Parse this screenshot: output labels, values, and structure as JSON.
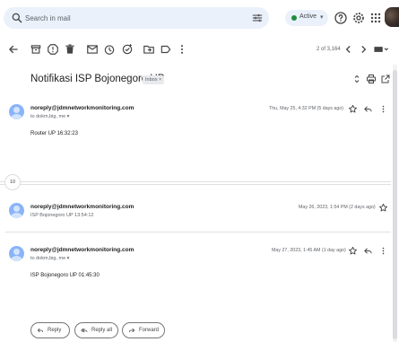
{
  "search": {
    "placeholder": "Search in mail"
  },
  "status": {
    "label": "Active",
    "chevron": "▾",
    "color": "#1e8e3e"
  },
  "top_icons": [
    "tune-icon",
    "help-icon",
    "settings-icon",
    "apps-icon",
    "avatar"
  ],
  "toolbar": {
    "icons": [
      "back-icon",
      "archive-icon",
      "report-spam-icon",
      "delete-icon",
      "mark-unread-icon",
      "snooze-icon",
      "add-task-icon",
      "move-to-icon",
      "label-icon",
      "more-icon"
    ],
    "pager": "2 of 3,164",
    "pager_icons": [
      "prev-icon",
      "next-icon",
      "input-tools-icon"
    ]
  },
  "email": {
    "subject": "Notifikasi ISP Bojonegoro UP",
    "label_chip": "Inbox ×",
    "subject_icons": [
      "expand-icon",
      "print-icon",
      "open-new-window-icon"
    ],
    "collapsed_count": "10",
    "messages": [
      {
        "sender": "noreply@jdmnetworkmonitoring.com",
        "to": "to dokm,big, me ▾",
        "date": "Thu, May 25, 4:32 PM (5 days ago)",
        "body": "Router UP 16:32:23",
        "expanded": true
      },
      {
        "sender": "noreply@jdmnetworkmonitoring.com",
        "snippet": "ISP Bojonegoro UP 13:54:12",
        "date": "May 26, 2023, 1:54 PM (2 days ago)",
        "expanded": false
      },
      {
        "sender": "noreply@jdmnetworkmonitoring.com",
        "to": "to dokm,big, me ▾",
        "date": "May 27, 2023, 1:45 AM (1 day ago)",
        "body": "ISP Bojonegoro UP 01:45:30",
        "expanded": true
      }
    ]
  },
  "actions": {
    "reply": "Reply",
    "reply_all": "Reply all",
    "forward": "Forward"
  },
  "colors": {
    "search_bg": "#eaf1fb",
    "avatar": "#8ab4f8",
    "text": "#202124",
    "muted": "#5f6368"
  }
}
